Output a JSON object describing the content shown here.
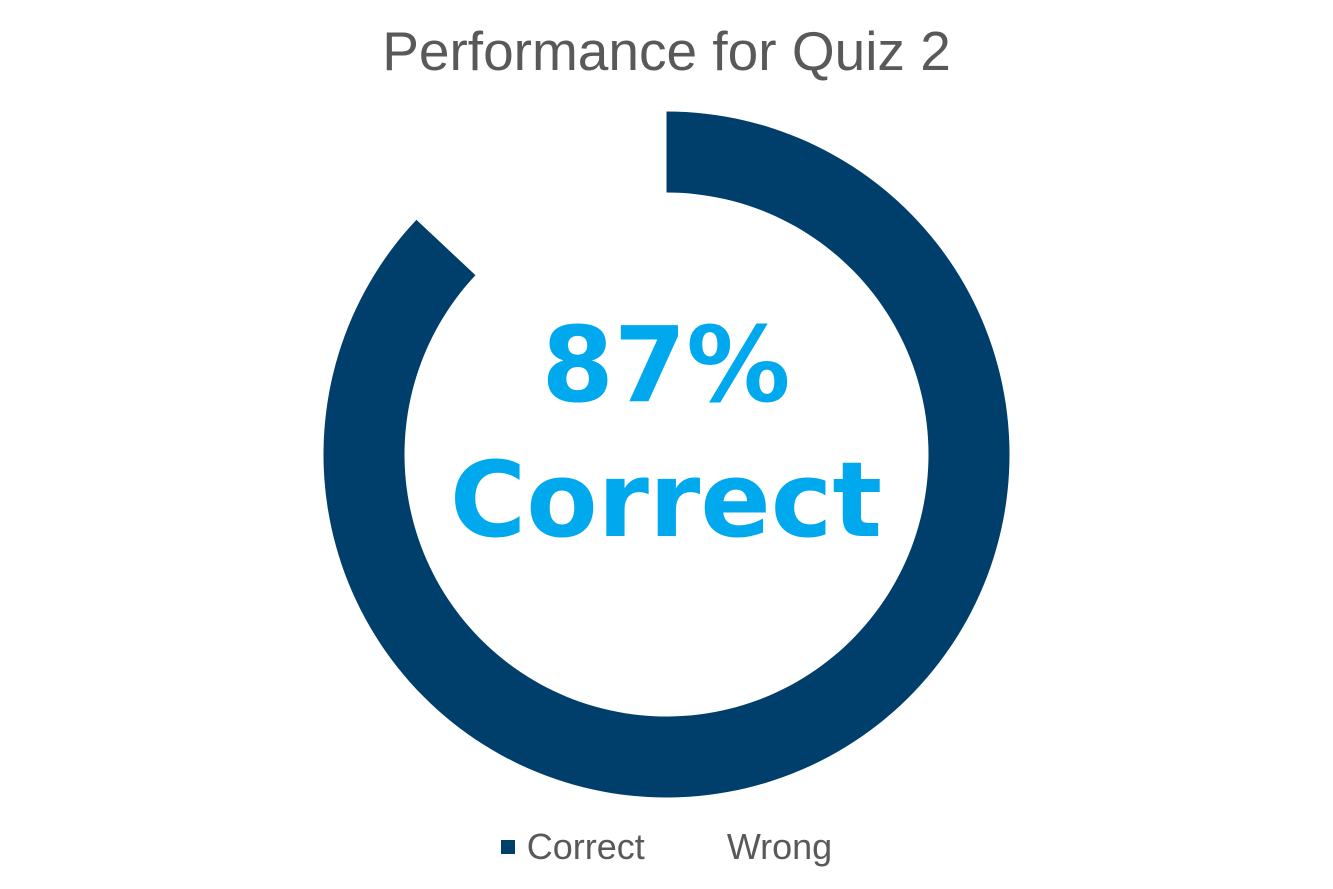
{
  "chart_data": {
    "type": "pie",
    "title": "Performance for Quiz 2",
    "categories": [
      "Correct",
      "Wrong"
    ],
    "values": [
      87,
      13
    ],
    "colors": [
      "#003f6b",
      "#ffffff"
    ],
    "center_value": "87%",
    "center_text": "Correct",
    "center_color": "#00a9ee",
    "legend": {
      "position": "bottom",
      "items": [
        "Correct",
        "Wrong"
      ]
    }
  }
}
